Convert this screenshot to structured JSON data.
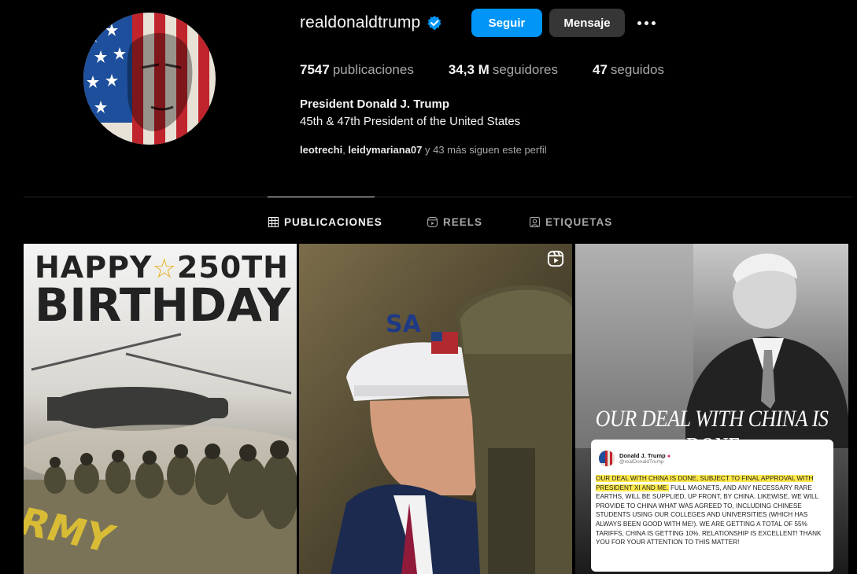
{
  "profile": {
    "username": "realdonaldtrump",
    "follow_label": "Seguir",
    "message_label": "Mensaje",
    "stats": {
      "posts_count": "7547",
      "posts_label": "publicaciones",
      "followers_count": "34,3 M",
      "followers_label": "seguidores",
      "following_count": "47",
      "following_label": "seguidos"
    },
    "bio_name": "President Donald J. Trump",
    "bio_text": "45th & 47th President of the United States",
    "followed_by": {
      "user1": "leotrechi",
      "separator": ", ",
      "user2": "leidymariana07",
      "rest": " y 43 más siguen este perfil"
    }
  },
  "tabs": [
    {
      "label": "PUBLICACIONES",
      "icon": "grid-icon",
      "active": true
    },
    {
      "label": "REELS",
      "icon": "reels-icon",
      "active": false
    },
    {
      "label": "ETIQUETAS",
      "icon": "tag-icon",
      "active": false
    }
  ],
  "posts": [
    {
      "line1": "HAPPY",
      "line1b": "250TH",
      "line2": "BIRTHDAY",
      "ground_text": "ARMY"
    },
    {
      "cap_text": "SA"
    },
    {
      "headline": "OUR DEAL WITH CHINA IS DONE",
      "tweet_name": "Donald J. Trump",
      "tweet_handle": "@realDonaldTrump",
      "tweet_highlight": "Our deal with China is done, subject to final approval with President Xi and me.",
      "tweet_rest": " Full magnets, and any necessary rare earths, will be supplied, up front, by China. Likewise, we will provide to China what was agreed to, including Chinese students using our colleges and universities (which has always been good with me!). We are getting a total of 55% tariffs, China is getting 10%. Relationship is excellent! Thank you for your attention to this matter!"
    }
  ],
  "colors": {
    "accent": "#0095f6",
    "secondary_button": "#363636",
    "verified": "#0095f6",
    "muted_text": "#a8a8a8"
  }
}
